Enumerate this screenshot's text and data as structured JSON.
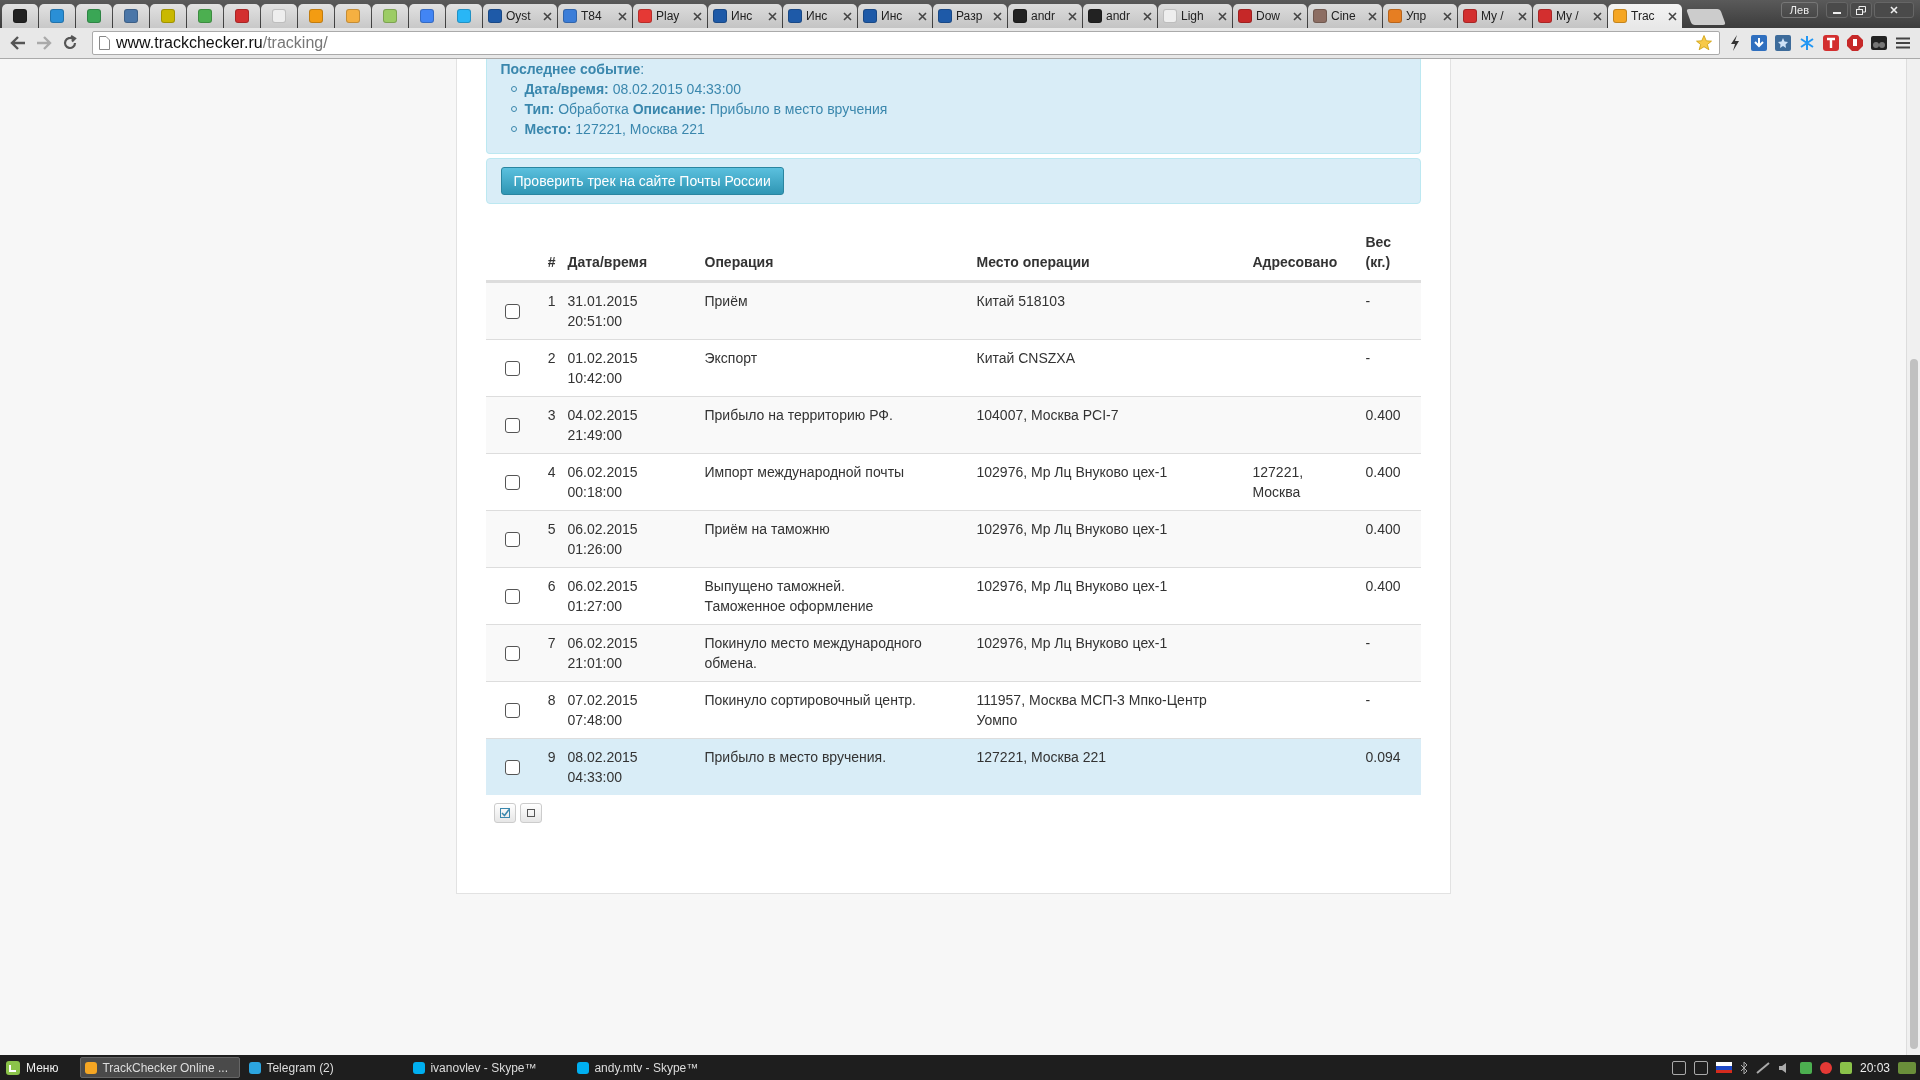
{
  "browser": {
    "user": "Лев",
    "pinned_tabs": [
      {
        "color": "#222222"
      },
      {
        "color": "#2a8fd6"
      },
      {
        "color": "#3aa655"
      },
      {
        "color": "#4a76a8"
      },
      {
        "color": "#c9b800"
      },
      {
        "color": "#4caf50"
      },
      {
        "color": "#d32f2f"
      },
      {
        "color": "#eeeeee"
      },
      {
        "color": "#f39c12"
      },
      {
        "color": "#f5b041"
      },
      {
        "color": "#9ccc65"
      },
      {
        "color": "#4285f4"
      },
      {
        "color": "#29b6f6"
      }
    ],
    "tabs": [
      {
        "title": "Oyst",
        "color": "#1e5aa8",
        "selected": false
      },
      {
        "title": "T84",
        "color": "#3b7dd8",
        "selected": false
      },
      {
        "title": "Play",
        "color": "#e53935",
        "selected": false
      },
      {
        "title": "Инс",
        "color": "#1e5aa8",
        "selected": false
      },
      {
        "title": "Инс",
        "color": "#1e5aa8",
        "selected": false
      },
      {
        "title": "Инс",
        "color": "#1e5aa8",
        "selected": false
      },
      {
        "title": "Разр",
        "color": "#1e5aa8",
        "selected": false
      },
      {
        "title": "andr",
        "color": "#222222",
        "selected": false
      },
      {
        "title": "andr",
        "color": "#222222",
        "selected": false
      },
      {
        "title": "Ligh",
        "color": "#eeeeee",
        "selected": false
      },
      {
        "title": "Dow",
        "color": "#c62828",
        "selected": false
      },
      {
        "title": "Cine",
        "color": "#8d6e63",
        "selected": false
      },
      {
        "title": "Упр",
        "color": "#e67e22",
        "selected": false
      },
      {
        "title": "My /",
        "color": "#d32f2f",
        "selected": false
      },
      {
        "title": "My /",
        "color": "#d32f2f",
        "selected": false
      },
      {
        "title": "Trac",
        "color": "#f5a623",
        "selected": true
      }
    ],
    "address": {
      "host": "www.trackchecker.ru",
      "path": "/tracking/"
    }
  },
  "last_event": {
    "title": "**Последнее событие**:",
    "items": [
      "**Дата/время:** 08.02.2015 04:33:00",
      "**Тип:** Обработка **Описание:** Прибыло в место вручения",
      "**Место:** 127221, Москва 221"
    ]
  },
  "check_button": "Проверить трек на сайте Почты России",
  "table": {
    "columns": [
      "#",
      "Дата/время",
      "Операция",
      "Место операции",
      "Адресовано",
      "Вес (кг.)"
    ],
    "rows": [
      {
        "num": "1",
        "date": "31.01.2015",
        "time": "20:51:00",
        "operation": "Приём",
        "place": "Китай 518103",
        "addressed": "",
        "weight": "-",
        "checked": false,
        "selected": false
      },
      {
        "num": "2",
        "date": "01.02.2015",
        "time": "10:42:00",
        "operation": "Экспорт",
        "place": "Китай CNSZXA",
        "addressed": "",
        "weight": "-",
        "checked": false,
        "selected": false
      },
      {
        "num": "3",
        "date": "04.02.2015",
        "time": "21:49:00",
        "operation": "Прибыло на территорию РФ.",
        "place": "104007, Москва PCI-7",
        "addressed": "",
        "weight": "0.400",
        "checked": false,
        "selected": false
      },
      {
        "num": "4",
        "date": "06.02.2015",
        "time": "00:18:00",
        "operation": "Импорт международной почты",
        "place": "102976, Мр Лц Внуково цех-1",
        "addressed": "127221, Москва",
        "weight": "0.400",
        "checked": false,
        "selected": false
      },
      {
        "num": "5",
        "date": "06.02.2015",
        "time": "01:26:00",
        "operation": "Приём на таможню",
        "place": "102976, Мр Лц Внуково цех-1",
        "addressed": "",
        "weight": "0.400",
        "checked": false,
        "selected": false
      },
      {
        "num": "6",
        "date": "06.02.2015",
        "time": "01:27:00",
        "operation": "Выпущено таможней.\nТаможенное оформление",
        "place": "102976, Мр Лц Внуково цех-1",
        "addressed": "",
        "weight": "0.400",
        "checked": false,
        "selected": false
      },
      {
        "num": "7",
        "date": "06.02.2015",
        "time": "21:01:00",
        "operation": "Покинуло место международного обмена.",
        "place": "102976, Мр Лц Внуково цех-1",
        "addressed": "",
        "weight": "-",
        "checked": false,
        "selected": false
      },
      {
        "num": "8",
        "date": "07.02.2015",
        "time": "07:48:00",
        "operation": "Покинуло сортировочный центр.",
        "place": "111957, Москва МСП-3 Мпко-Центр Уомпо",
        "addressed": "",
        "weight": "-",
        "checked": false,
        "selected": false
      },
      {
        "num": "9",
        "date": "08.02.2015",
        "time": "04:33:00",
        "operation": "Прибыло в место вручения.",
        "place": "127221, Москва 221",
        "addressed": "",
        "weight": "0.094",
        "checked": false,
        "selected": true
      }
    ]
  },
  "taskbar": {
    "menu": "Меню",
    "windows": [
      {
        "title": "TrackChecker Online ...",
        "selected": true,
        "color": "#f5a623"
      },
      {
        "title": "Telegram (2)",
        "selected": false,
        "color": "#2ca5e0"
      },
      {
        "title": "ivanovlev - Skype™",
        "selected": false,
        "color": "#00aff0"
      },
      {
        "title": "andy.mtv - Skype™",
        "selected": false,
        "color": "#00aff0"
      }
    ],
    "clock": "20:03"
  }
}
